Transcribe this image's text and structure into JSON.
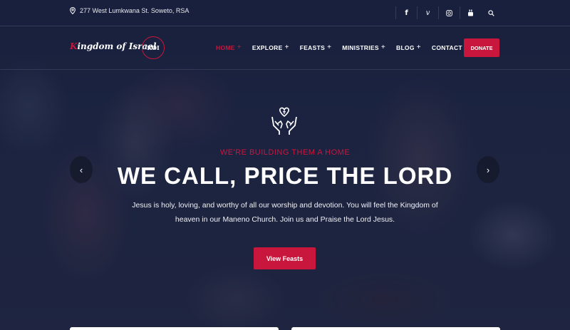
{
  "topbar": {
    "address": "277 West Lumkwana St. Soweto, RSA",
    "social": [
      "facebook-icon",
      "vimeo-icon",
      "instagram-icon",
      "youtube-icon",
      "search-icon"
    ]
  },
  "brand": {
    "first_letter": "K",
    "rest": "ingdom of Israel",
    "mark": "KOI"
  },
  "nav": {
    "items": [
      {
        "label": "HOME",
        "plus": "+"
      },
      {
        "label": "EXPLORE",
        "plus": "+"
      },
      {
        "label": "FEASTS",
        "plus": "+"
      },
      {
        "label": "MINISTRIES",
        "plus": "+"
      },
      {
        "label": "BLOG",
        "plus": "+"
      },
      {
        "label": "CONTACT US",
        "plus": ""
      }
    ],
    "donate_label": "DONATE"
  },
  "hero": {
    "eyebrow": "WE'RE BUILDING THEM A HOME",
    "headline": "WE CALL, PRICE THE LORD",
    "description": "Jesus is holy, loving, and worthy of all our worship and devotion. You will feel the Kingdom of heaven in our Maneno Church. Join us and Praise the Lord Jesus.",
    "cta_label": "View Feasts",
    "prev_arrow": "‹",
    "next_arrow": "›"
  },
  "colors": {
    "accent": "#c8163d",
    "overlay": "#161e3a"
  }
}
